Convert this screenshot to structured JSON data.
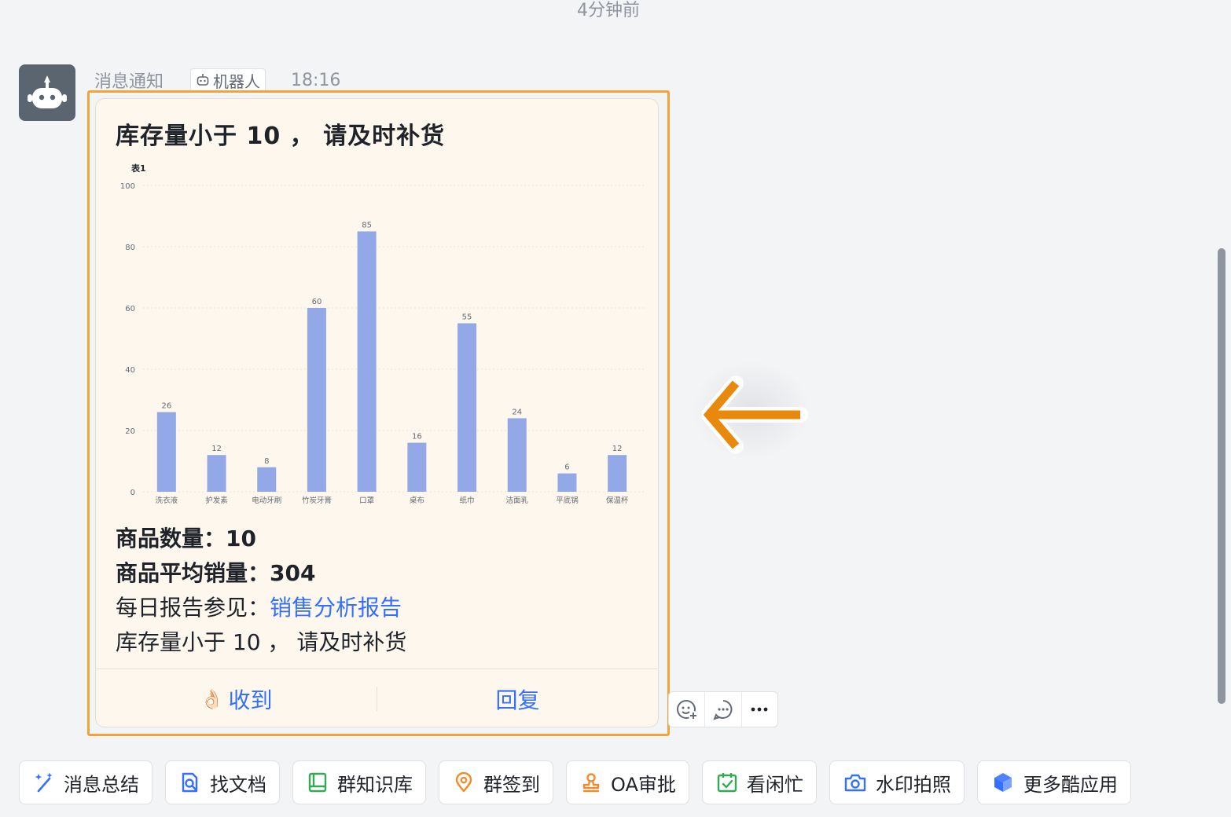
{
  "time_divider": "4分钟前",
  "sender": {
    "name": "消息通知",
    "tag": "机器人",
    "time": "18:16",
    "avatar": "robot-icon"
  },
  "card": {
    "title": "库存量小于 10 ， 请及时补货",
    "lines": {
      "count_label": "商品数量：",
      "count_value": "10",
      "avg_label": "商品平均销量：",
      "avg_value": "304",
      "report_label": "每日报告参见：",
      "report_link": "销售分析报告",
      "footer_text": "库存量小于 10 ， 请及时补货"
    },
    "actions": {
      "ack_emoji": "👌🏻",
      "ack_label": "收到",
      "reply_label": "回复"
    }
  },
  "chart_data": {
    "type": "bar",
    "title": "表1",
    "categories": [
      "洗衣液",
      "护发素",
      "电动牙刷",
      "竹炭牙膏",
      "口罩",
      "桌布",
      "纸巾",
      "洁面乳",
      "平底锅",
      "保温杯"
    ],
    "values": [
      26,
      12,
      8,
      60,
      85,
      16,
      55,
      24,
      6,
      12
    ],
    "ylim": [
      0,
      100
    ],
    "yticks": [
      0,
      20,
      40,
      60,
      80,
      100
    ],
    "bar_color": "#93a8e6",
    "data_labels": true,
    "grid": true
  },
  "hover_tools": [
    "add-reaction-icon",
    "reply-thread-icon",
    "more-icon"
  ],
  "toolbar": {
    "items": [
      {
        "label": "消息总结",
        "icon": "magic-wand-icon"
      },
      {
        "label": "找文档",
        "icon": "doc-search-icon"
      },
      {
        "label": "群知识库",
        "icon": "book-icon"
      },
      {
        "label": "群签到",
        "icon": "location-pin-icon"
      },
      {
        "label": "OA审批",
        "icon": "stamp-icon"
      },
      {
        "label": "看闲忙",
        "icon": "calendar-check-icon"
      },
      {
        "label": "水印拍照",
        "icon": "camera-icon"
      },
      {
        "label": "更多酷应用",
        "icon": "cube-icon"
      }
    ]
  },
  "colors": {
    "accent": "#3370ff",
    "highlight_border": "#f2a33a",
    "arrow": "#e8890c",
    "card_bg": "#fdf7ed"
  }
}
